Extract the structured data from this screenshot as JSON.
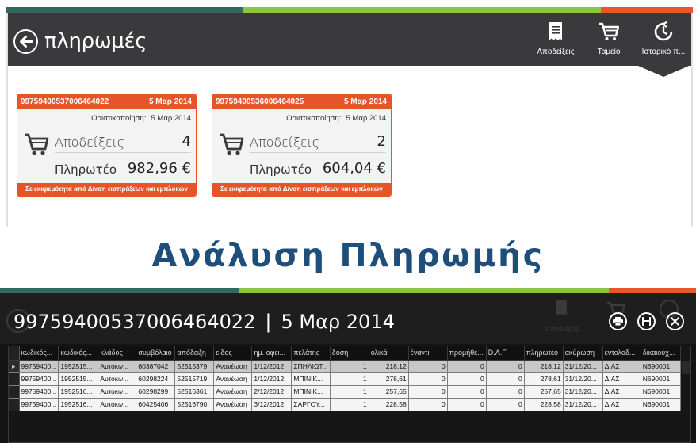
{
  "strips": [
    {
      "color": "#2e6a5f"
    },
    {
      "color": "#8cc63f"
    },
    {
      "color": "#e8562a"
    }
  ],
  "app": {
    "title": "πληρωμές",
    "nav": [
      {
        "label": "Αποδείξεις",
        "icon": "receipt-icon"
      },
      {
        "label": "Ταμείο",
        "icon": "shopping-cart-icon"
      },
      {
        "label": "Ιστορικό π...",
        "icon": "history-clock-icon"
      }
    ]
  },
  "cards": [
    {
      "code": "99759400537006464022",
      "date": "5 Μαρ 2014",
      "final_label": "Οριστικοποίηση:",
      "final_date": "5 Μαρ 2014",
      "receipts_label": "Αποδείξεις",
      "receipts_count": "4",
      "payable_label": "Πληρωτέο",
      "payable_amount": "982,96 €",
      "status": "Σε εκκρεμότητα από Δ/νση εισπράξεων και εμπλοκών"
    },
    {
      "code": "99759400536006464025",
      "date": "5 Μαρ 2014",
      "final_label": "Οριστικοποίηση:",
      "final_date": "5 Μαρ 2014",
      "receipts_label": "Αποδείξεις",
      "receipts_count": "2",
      "payable_label": "Πληρωτέο",
      "payable_amount": "604,04 €",
      "status": "Σε εκκρεμότητα από Δ/νση εισπράξεων και εμπλοκών"
    }
  ],
  "section_title": "Ανάλυση Πληρωμής",
  "detail": {
    "code": "99759400537006464022",
    "separator": "|",
    "date": "5 Μαρ 2014",
    "ghost_label": "Αποδείξεις",
    "buttons": [
      {
        "icon": "print-icon"
      },
      {
        "icon": "save-icon"
      },
      {
        "icon": "close-icon"
      }
    ],
    "columns": [
      "κωδικός...",
      "κωδικός...",
      "κλάδος",
      "συμβόλαιο",
      "απόδειξη",
      "είδος",
      "ημ. οφει...",
      "πελάτης",
      "δόση",
      "ολικά",
      "έναντι",
      "προμήθε...",
      "D.A.F",
      "πληρωτέο",
      "ακύρωση",
      "εντολοδ...",
      "δικαιούχ..."
    ],
    "rows": [
      [
        "99759400...",
        "1952515...",
        "Αυτοκιν...",
        "60387042",
        "52515379",
        "Ανανέωση",
        "1/12/2012",
        "ΣΠΗΛΙΩΤ...",
        "1",
        "218,12",
        "0",
        "0",
        "0",
        "218,12",
        "31/12/20...",
        "ΔΙΑΣ",
        "N690001"
      ],
      [
        "99759400...",
        "1952515...",
        "Αυτοκιν...",
        "60298224",
        "52515719",
        "Ανανέωση",
        "1/12/2012",
        "ΜΠΙΝΙΚ...",
        "1",
        "278,61",
        "0",
        "0",
        "0",
        "278,61",
        "31/12/20...",
        "ΔΙΑΣ",
        "N690001"
      ],
      [
        "99759400...",
        "1952516...",
        "Αυτοκιν...",
        "60298299",
        "52516361",
        "Ανανέωση",
        "2/12/2012",
        "ΜΠΙΝΙΚ...",
        "1",
        "257,65",
        "0",
        "0",
        "0",
        "257,65",
        "31/12/20...",
        "ΔΙΑΣ",
        "N690001"
      ],
      [
        "99759400...",
        "1952516...",
        "Αυτοκιν...",
        "60425406",
        "52516790",
        "Ανανέωση",
        "3/12/2012",
        "ΣΑΡΓΟΥ...",
        "1",
        "228,58",
        "0",
        "0",
        "0",
        "228,58",
        "31/12/20...",
        "ΔΙΑΣ",
        "N690001"
      ]
    ],
    "numeric_columns": [
      8,
      9,
      10,
      11,
      12,
      13
    ]
  }
}
